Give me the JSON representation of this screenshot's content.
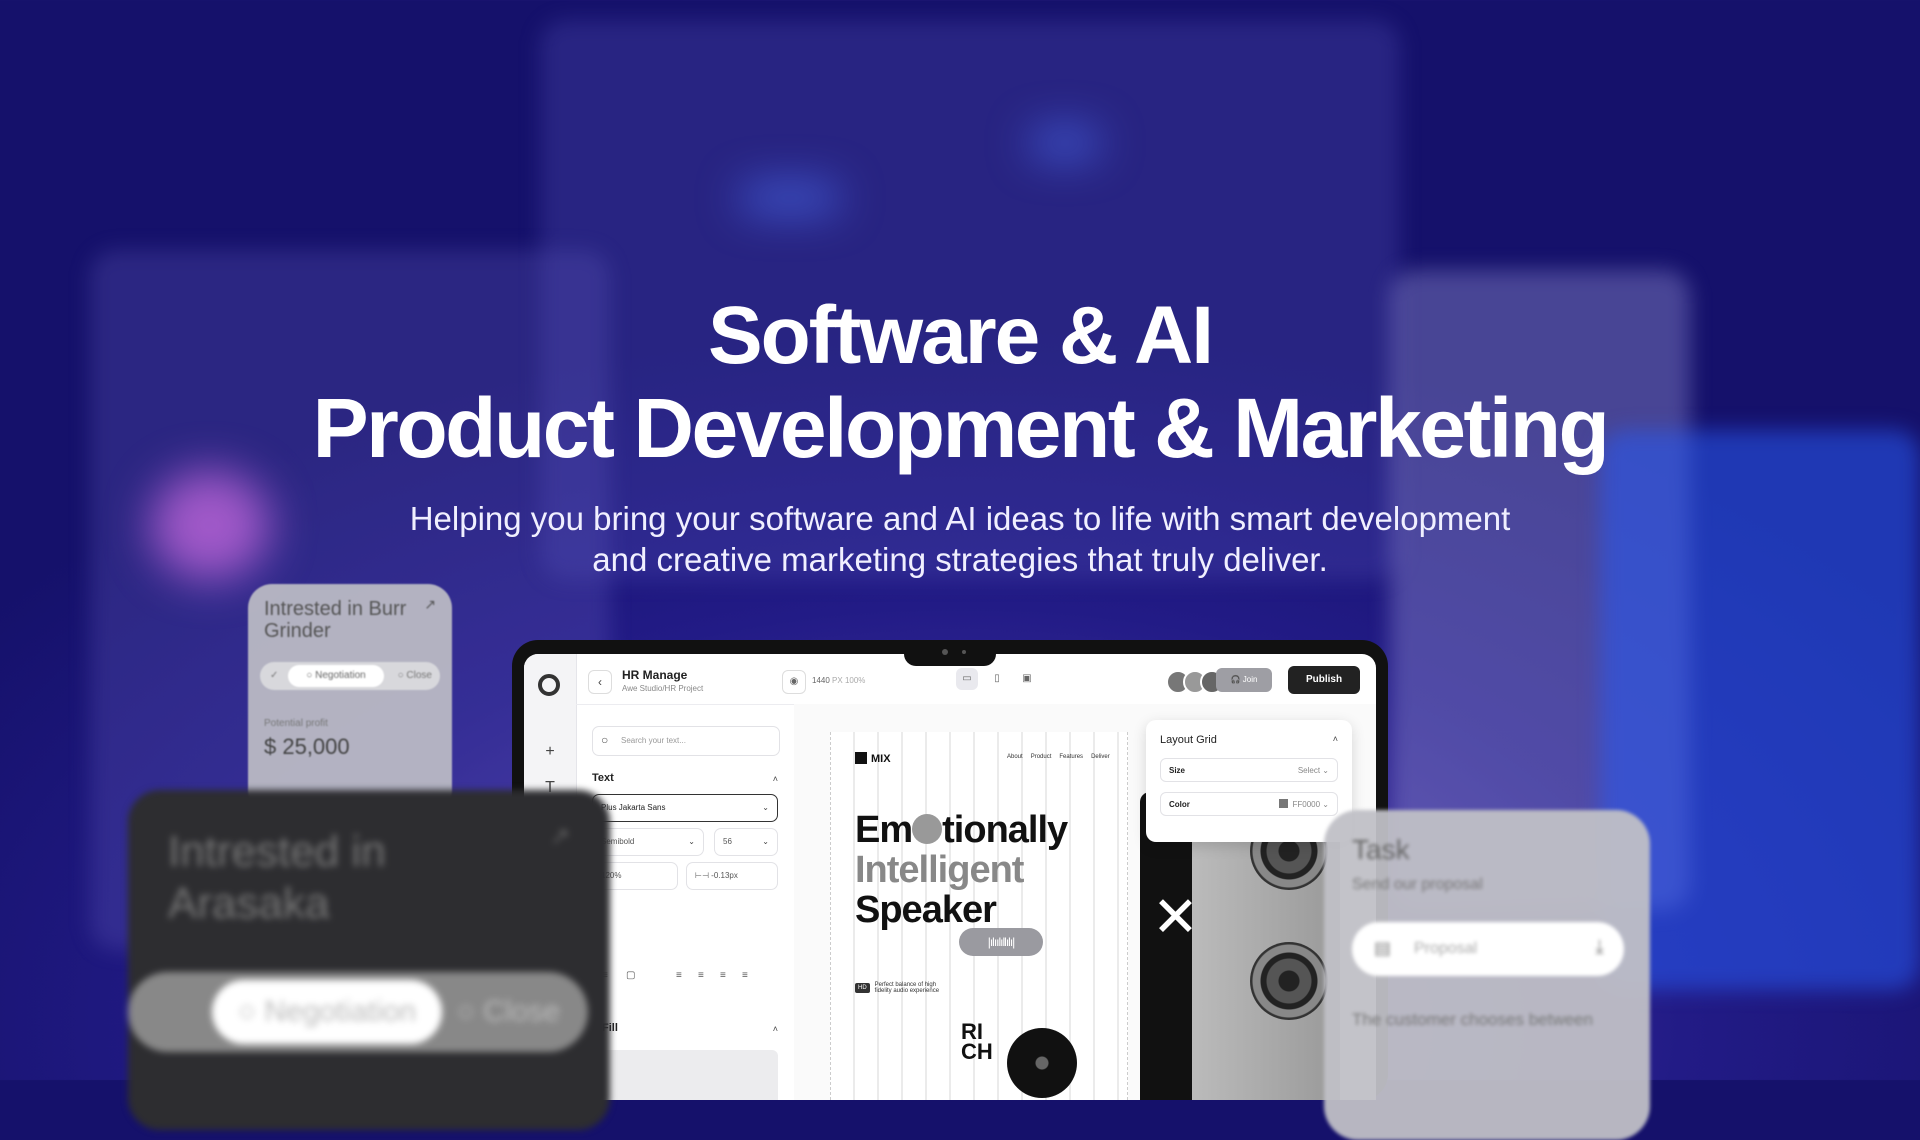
{
  "hero": {
    "title_line1": "Software & AI",
    "title_line2": "Product Development & Marketing",
    "subtitle_line1": "Helping you bring your software and AI ideas to life with smart development",
    "subtitle_line2": "and creative marketing strategies that truly deliver."
  },
  "editor": {
    "project_name": "HR Manage",
    "project_path": "Awe Studio/HR Project",
    "canvas_width": "1440",
    "canvas_unit": "PX",
    "zoom": "100%",
    "join_label": "Join",
    "publish_label": "Publish",
    "search_placeholder": "Search your text...",
    "text_section": "Text",
    "font_family": "Plus Jakarta Sans",
    "font_weight": "Semibold",
    "font_size": "56",
    "line_height": "120%",
    "letter_spacing": "-0.13px",
    "fill_section": "Fill"
  },
  "artboard": {
    "brand": "MIX",
    "nav": [
      "About",
      "Product",
      "Features",
      "Deliver"
    ],
    "heading_part1": "Em",
    "heading_part2": "tionally",
    "heading_line2": "Intelligent",
    "heading_line3": "Speaker",
    "hd_badge": "HD",
    "hd_text_line1": "Perfect balance of high",
    "hd_text_line2": "fidelity audio experience",
    "product_text_line1": "RI",
    "product_text_line2": "CH"
  },
  "layout_grid": {
    "title": "Layout Grid",
    "size_label": "Size",
    "size_value": "Select",
    "color_label": "Color",
    "color_value": "FF0000"
  },
  "deal_card_small": {
    "title": "Intrested in Burr Grinder",
    "stage_active": "Negotiation",
    "stage_next": "Close",
    "profit_label": "Potential profit",
    "profit_value": "$ 25,000"
  },
  "deal_card_large": {
    "title": "Intrested in Arasaka",
    "stage_active": "Negotiation",
    "stage_next": "Close"
  },
  "task_card": {
    "title": "Task",
    "subtitle": "Send our proposal",
    "file_label": "Proposal",
    "question": "The customer chooses between"
  },
  "colors": {
    "background_deep": "#15116b",
    "background_glow": "#6a4fb4",
    "publish_button": "#222222"
  }
}
